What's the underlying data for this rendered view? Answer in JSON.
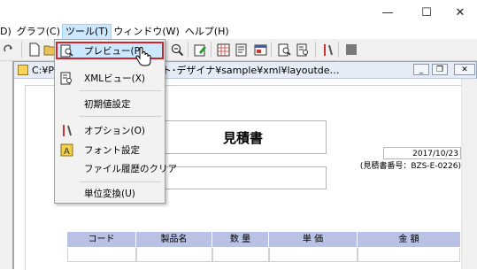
{
  "window": {
    "minimize": "—",
    "maximize": "☐",
    "close": "✕"
  },
  "menubar": {
    "items": [
      {
        "label": "D)",
        "name": "menu-file"
      },
      {
        "label": "グラフ(C)",
        "name": "menu-graph"
      },
      {
        "label": "ツール(T)",
        "name": "menu-tools"
      },
      {
        "label": "ウィンドウ(W)",
        "name": "menu-window"
      },
      {
        "label": "ヘルプ(H)",
        "name": "menu-help"
      }
    ]
  },
  "child_window": {
    "title": "C:¥Pr                    ¥biz-Stream レイアウト･デザイナ¥sample¥xml¥layoutde…",
    "minimize": "_",
    "restore": "❐",
    "close": "✕"
  },
  "tools_menu": {
    "items": [
      {
        "label": "プレビュー(P)",
        "icon": "preview-icon"
      },
      {
        "label": "XMLビュー(X)",
        "icon": "xml-view-icon"
      },
      {
        "label": "初期値設定",
        "icon": ""
      },
      {
        "label": "オプション(O)",
        "icon": "options-icon"
      },
      {
        "label": "フォント設定",
        "icon": "font-settings-icon"
      },
      {
        "label": "ファイル履歴のクリア",
        "icon": ""
      },
      {
        "label": "単位変換(U)",
        "icon": ""
      }
    ]
  },
  "document": {
    "title": "見積書",
    "date": "2017/10/23",
    "estimate_no": "(見積書番号：BZS-E-0226)",
    "table_headers": [
      "コード",
      "製品名",
      "数 量",
      "単 価",
      "金 額"
    ]
  },
  "colors": {
    "menu_highlight": "#cce8ff",
    "highlight_border": "#d0262b",
    "table_header": "#b9c1e4"
  }
}
